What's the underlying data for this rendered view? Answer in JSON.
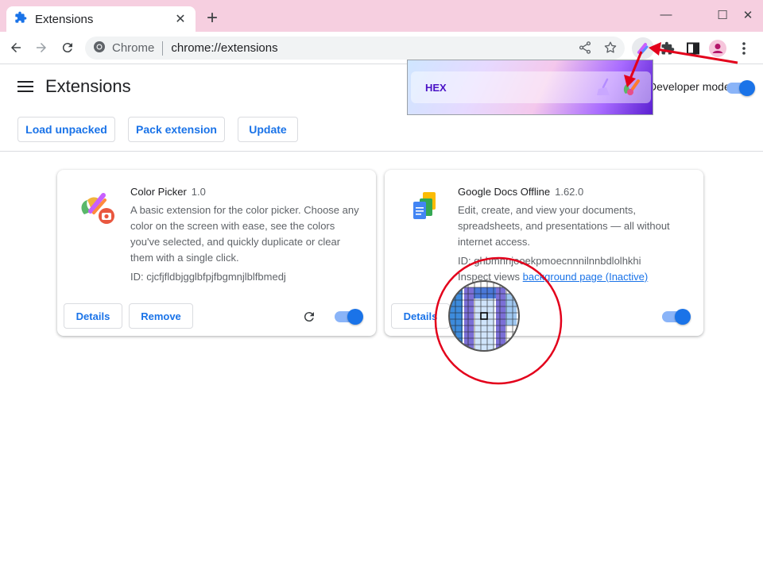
{
  "browser": {
    "tab_title": "Extensions",
    "tab_close": "✕",
    "new_tab": "+",
    "omnibox_chrome_label": "Chrome",
    "omnibox_url": "chrome://extensions",
    "window_minimize": "—",
    "window_maximize": "☐",
    "window_close": "✕"
  },
  "page": {
    "title": "Extensions",
    "developer_mode_label": "Developer mode",
    "developer_mode_on": true,
    "buttons": {
      "load_unpacked": "Load unpacked",
      "pack_extension": "Pack extension",
      "update": "Update"
    }
  },
  "extensions": [
    {
      "name": "Color Picker",
      "version": "1.0",
      "description": "A basic extension for the color picker. Choose any color on the screen with ease, see the colors you've selected, and quickly duplicate or clear them with a single click.",
      "id_text": "ID: cjcfjfldbjgglbfpjfbgmnjlblfbmedj",
      "details_label": "Details",
      "remove_label": "Remove",
      "enabled": true
    },
    {
      "name": "Google Docs Offline",
      "version": "1.62.0",
      "description": "Edit, create, and view your documents, spreadsheets, and presentations — all without internet access.",
      "id_text": "ID: ghbmnnjooekpmoecnnnilnnbdlolhkhi",
      "inspect_label": "Inspect views",
      "inspect_link": "background page (Inactive)",
      "details_label": "Details",
      "enabled": true
    }
  ],
  "popup": {
    "hex_label": "HEX"
  },
  "colors": {
    "accent": "#1a73e8",
    "tabstrip": "#f6cfe0",
    "annotation_red": "#e3001b"
  }
}
